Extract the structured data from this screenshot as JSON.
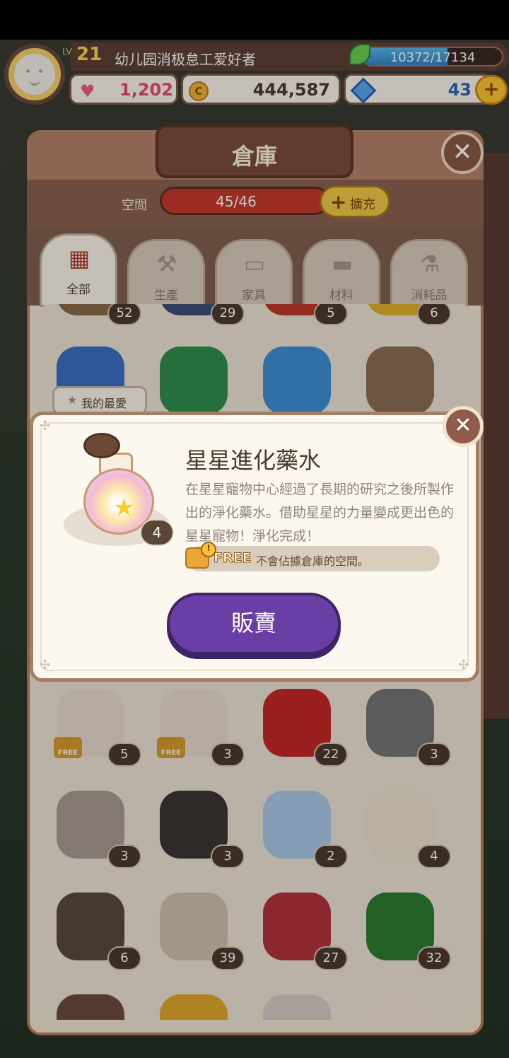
{
  "hud": {
    "level_prefix": "LV",
    "level": "21",
    "username": "幼儿园消极怠工爱好者",
    "xp_text": "10372/17134",
    "xp_progress": 0.605,
    "hearts": "1,202",
    "coins": "444,587",
    "gems": "43"
  },
  "warehouse": {
    "title": "倉庫",
    "space_label": "空間",
    "capacity": "45/46",
    "expand_label": "擴充"
  },
  "tabs": [
    {
      "label": "全部",
      "icon": "grid-icon",
      "active": true
    },
    {
      "label": "生產",
      "icon": "hammer-icon",
      "active": false
    },
    {
      "label": "家具",
      "icon": "sofa-icon",
      "active": false
    },
    {
      "label": "材料",
      "icon": "wood-log-icon",
      "active": false
    },
    {
      "label": "消耗品",
      "icon": "potion-icon",
      "active": false
    }
  ],
  "favorite_tag": "我的最愛",
  "items": [
    {
      "count": "52",
      "free": false,
      "icon": "seed-icon",
      "color": "#8a6a4a"
    },
    {
      "count": "29",
      "free": false,
      "icon": "berry-icon",
      "color": "#3d4e7a"
    },
    {
      "count": "5",
      "free": false,
      "icon": "red-item-icon",
      "color": "#c0392b"
    },
    {
      "count": "6",
      "free": false,
      "icon": "yellow-item-icon",
      "color": "#e1b12c"
    },
    {
      "count": "",
      "free": false,
      "icon": "blue-fruit-icon",
      "color": "#3b6fc4"
    },
    {
      "count": "",
      "free": false,
      "icon": "green-fruit-icon",
      "color": "#2f8f4e"
    },
    {
      "count": "",
      "free": false,
      "icon": "blue-leaf-icon",
      "color": "#3f8fd6"
    },
    {
      "count": "",
      "free": false,
      "icon": "brown-leaf-icon",
      "color": "#8d6e55"
    },
    {
      "count": "5",
      "free": true,
      "icon": "blueprint-icon",
      "color": "#e8dcd0"
    },
    {
      "count": "3",
      "free": true,
      "icon": "blueprint-icon",
      "color": "#e8dcd0"
    },
    {
      "count": "22",
      "free": false,
      "icon": "red-ribbon-icon",
      "color": "#c62828"
    },
    {
      "count": "3",
      "free": false,
      "icon": "nail-icon",
      "color": "#757575"
    },
    {
      "count": "3",
      "free": false,
      "icon": "stone-icon",
      "color": "#a89c92"
    },
    {
      "count": "3",
      "free": false,
      "icon": "charcoal-log-icon",
      "color": "#3b3633"
    },
    {
      "count": "2",
      "free": false,
      "icon": "glass-pitcher-icon",
      "color": "#a9c9e8"
    },
    {
      "count": "4",
      "free": false,
      "icon": "cloth-icon",
      "color": "#eee2cc"
    },
    {
      "count": "6",
      "free": false,
      "icon": "wood-panel-icon",
      "color": "#5a4a40"
    },
    {
      "count": "39",
      "free": false,
      "icon": "fur-icon",
      "color": "#d2c1ad"
    },
    {
      "count": "27",
      "free": false,
      "icon": "meat-icon",
      "color": "#b3343a"
    },
    {
      "count": "32",
      "free": false,
      "icon": "spinach-icon",
      "color": "#2e7d32"
    },
    {
      "count": "",
      "free": false,
      "icon": "brown-block-icon",
      "color": "#6d4c3d"
    },
    {
      "count": "",
      "free": false,
      "icon": "golden-key-icon",
      "color": "#e0a82e"
    },
    {
      "count": "",
      "free": false,
      "icon": "recipe-clipboard-icon",
      "color": "#d7ccc8"
    },
    {
      "count": "",
      "free": false,
      "icon": "red-pattern-paper-icon",
      "color": "#f1e3d8"
    }
  ],
  "popup": {
    "item_name": "星星進化藥水",
    "description": "在星星寵物中心經過了長期的研究之後所製作出的淨化藥水。借助星星的力量變成更出色的星星寵物！淨化完成！",
    "count": "4",
    "free_badge": "FREE",
    "free_note": "不會佔據倉庫的空間。",
    "sell_label": "販賣"
  },
  "colors": {
    "accent_purple": "#6a3fa5",
    "panel_brown": "#b6826a",
    "capacity_red": "#c7392f",
    "xp_blue": "#3a96d9",
    "coin_gold": "#f2b43a",
    "heart_pink": "#ef5f85"
  }
}
